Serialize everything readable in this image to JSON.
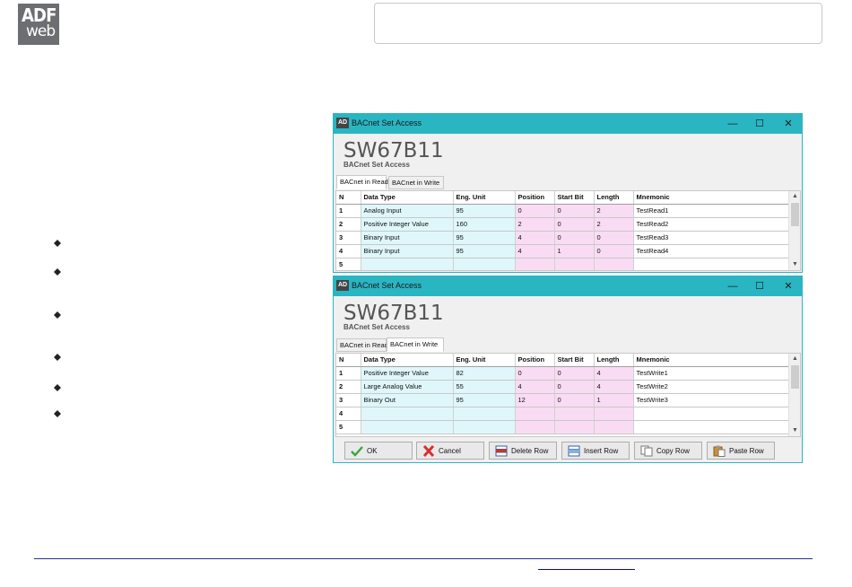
{
  "logo": {
    "line1": "ADF",
    "line2": "web"
  },
  "windows": [
    {
      "title": "BACnet Set Access",
      "big_title": "SW67B11",
      "subtitle": "BACnet Set Access",
      "tabs": [
        "BACnet in Read",
        "BACnet in Write"
      ],
      "active_tab": 0,
      "columns": [
        "N",
        "Data Type",
        "Eng. Unit",
        "Position",
        "Start Bit",
        "Length",
        "Mnemonic"
      ],
      "rows": [
        [
          "1",
          "Analog Input",
          "95",
          "0",
          "0",
          "2",
          "TestRead1"
        ],
        [
          "2",
          "Positive Integer Value",
          "160",
          "2",
          "0",
          "2",
          "TestRead2"
        ],
        [
          "3",
          "Binary Input",
          "95",
          "4",
          "0",
          "0",
          "TestRead3"
        ],
        [
          "4",
          "Binary Input",
          "95",
          "4",
          "1",
          "0",
          "TestRead4"
        ],
        [
          "5",
          "",
          "",
          "",
          "",
          "",
          ""
        ]
      ]
    },
    {
      "title": "BACnet Set Access",
      "big_title": "SW67B11",
      "subtitle": "BACnet Set Access",
      "tabs": [
        "BACnet in Read",
        "BACnet in Write"
      ],
      "active_tab": 1,
      "columns": [
        "N",
        "Data Type",
        "Eng. Unit",
        "Position",
        "Start Bit",
        "Length",
        "Mnemonic"
      ],
      "rows": [
        [
          "1",
          "Positive Integer Value",
          "82",
          "0",
          "0",
          "4",
          "TestWrite1"
        ],
        [
          "2",
          "Large Analog Value",
          "55",
          "4",
          "0",
          "4",
          "TestWrite2"
        ],
        [
          "3",
          "Binary Out",
          "95",
          "12",
          "0",
          "1",
          "TestWrite3"
        ],
        [
          "4",
          "",
          "",
          "",
          "",
          "",
          ""
        ],
        [
          "5",
          "",
          "",
          "",
          "",
          "",
          ""
        ]
      ],
      "buttons": [
        "OK",
        "Cancel",
        "Delete Row",
        "Insert Row",
        "Copy Row",
        "Paste Row"
      ]
    }
  ],
  "window_controls": {
    "minimize": "—",
    "maximize": "☐",
    "close": "✕"
  },
  "colors": {
    "titlebar": "#2ab5c2",
    "cyan_cell": "#dff7fb",
    "pink_cell": "#f9dcf3",
    "footer_line": "#2e3192"
  }
}
